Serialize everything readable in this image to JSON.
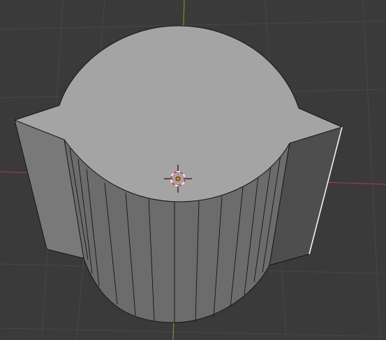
{
  "viewport": {
    "background_color": "#3a3a3a",
    "grid_color": "#474747",
    "x_axis_color": "#a3384a",
    "y_axis_color": "#6a9a1f"
  },
  "object": {
    "top_face_color": "#a4a4a4",
    "cylinder_side_color": "#6c6c6c",
    "left_wing_color": "#797979",
    "right_wing_color": "#4e4e4e",
    "edge_color": "#141414",
    "selected_edge_color": "#f2f2f2"
  },
  "cursor": {
    "icon": "3d-cursor-icon",
    "ring_colors": [
      "#e03a3a",
      "#f2f2f2"
    ],
    "center_color": "#e07a20"
  }
}
